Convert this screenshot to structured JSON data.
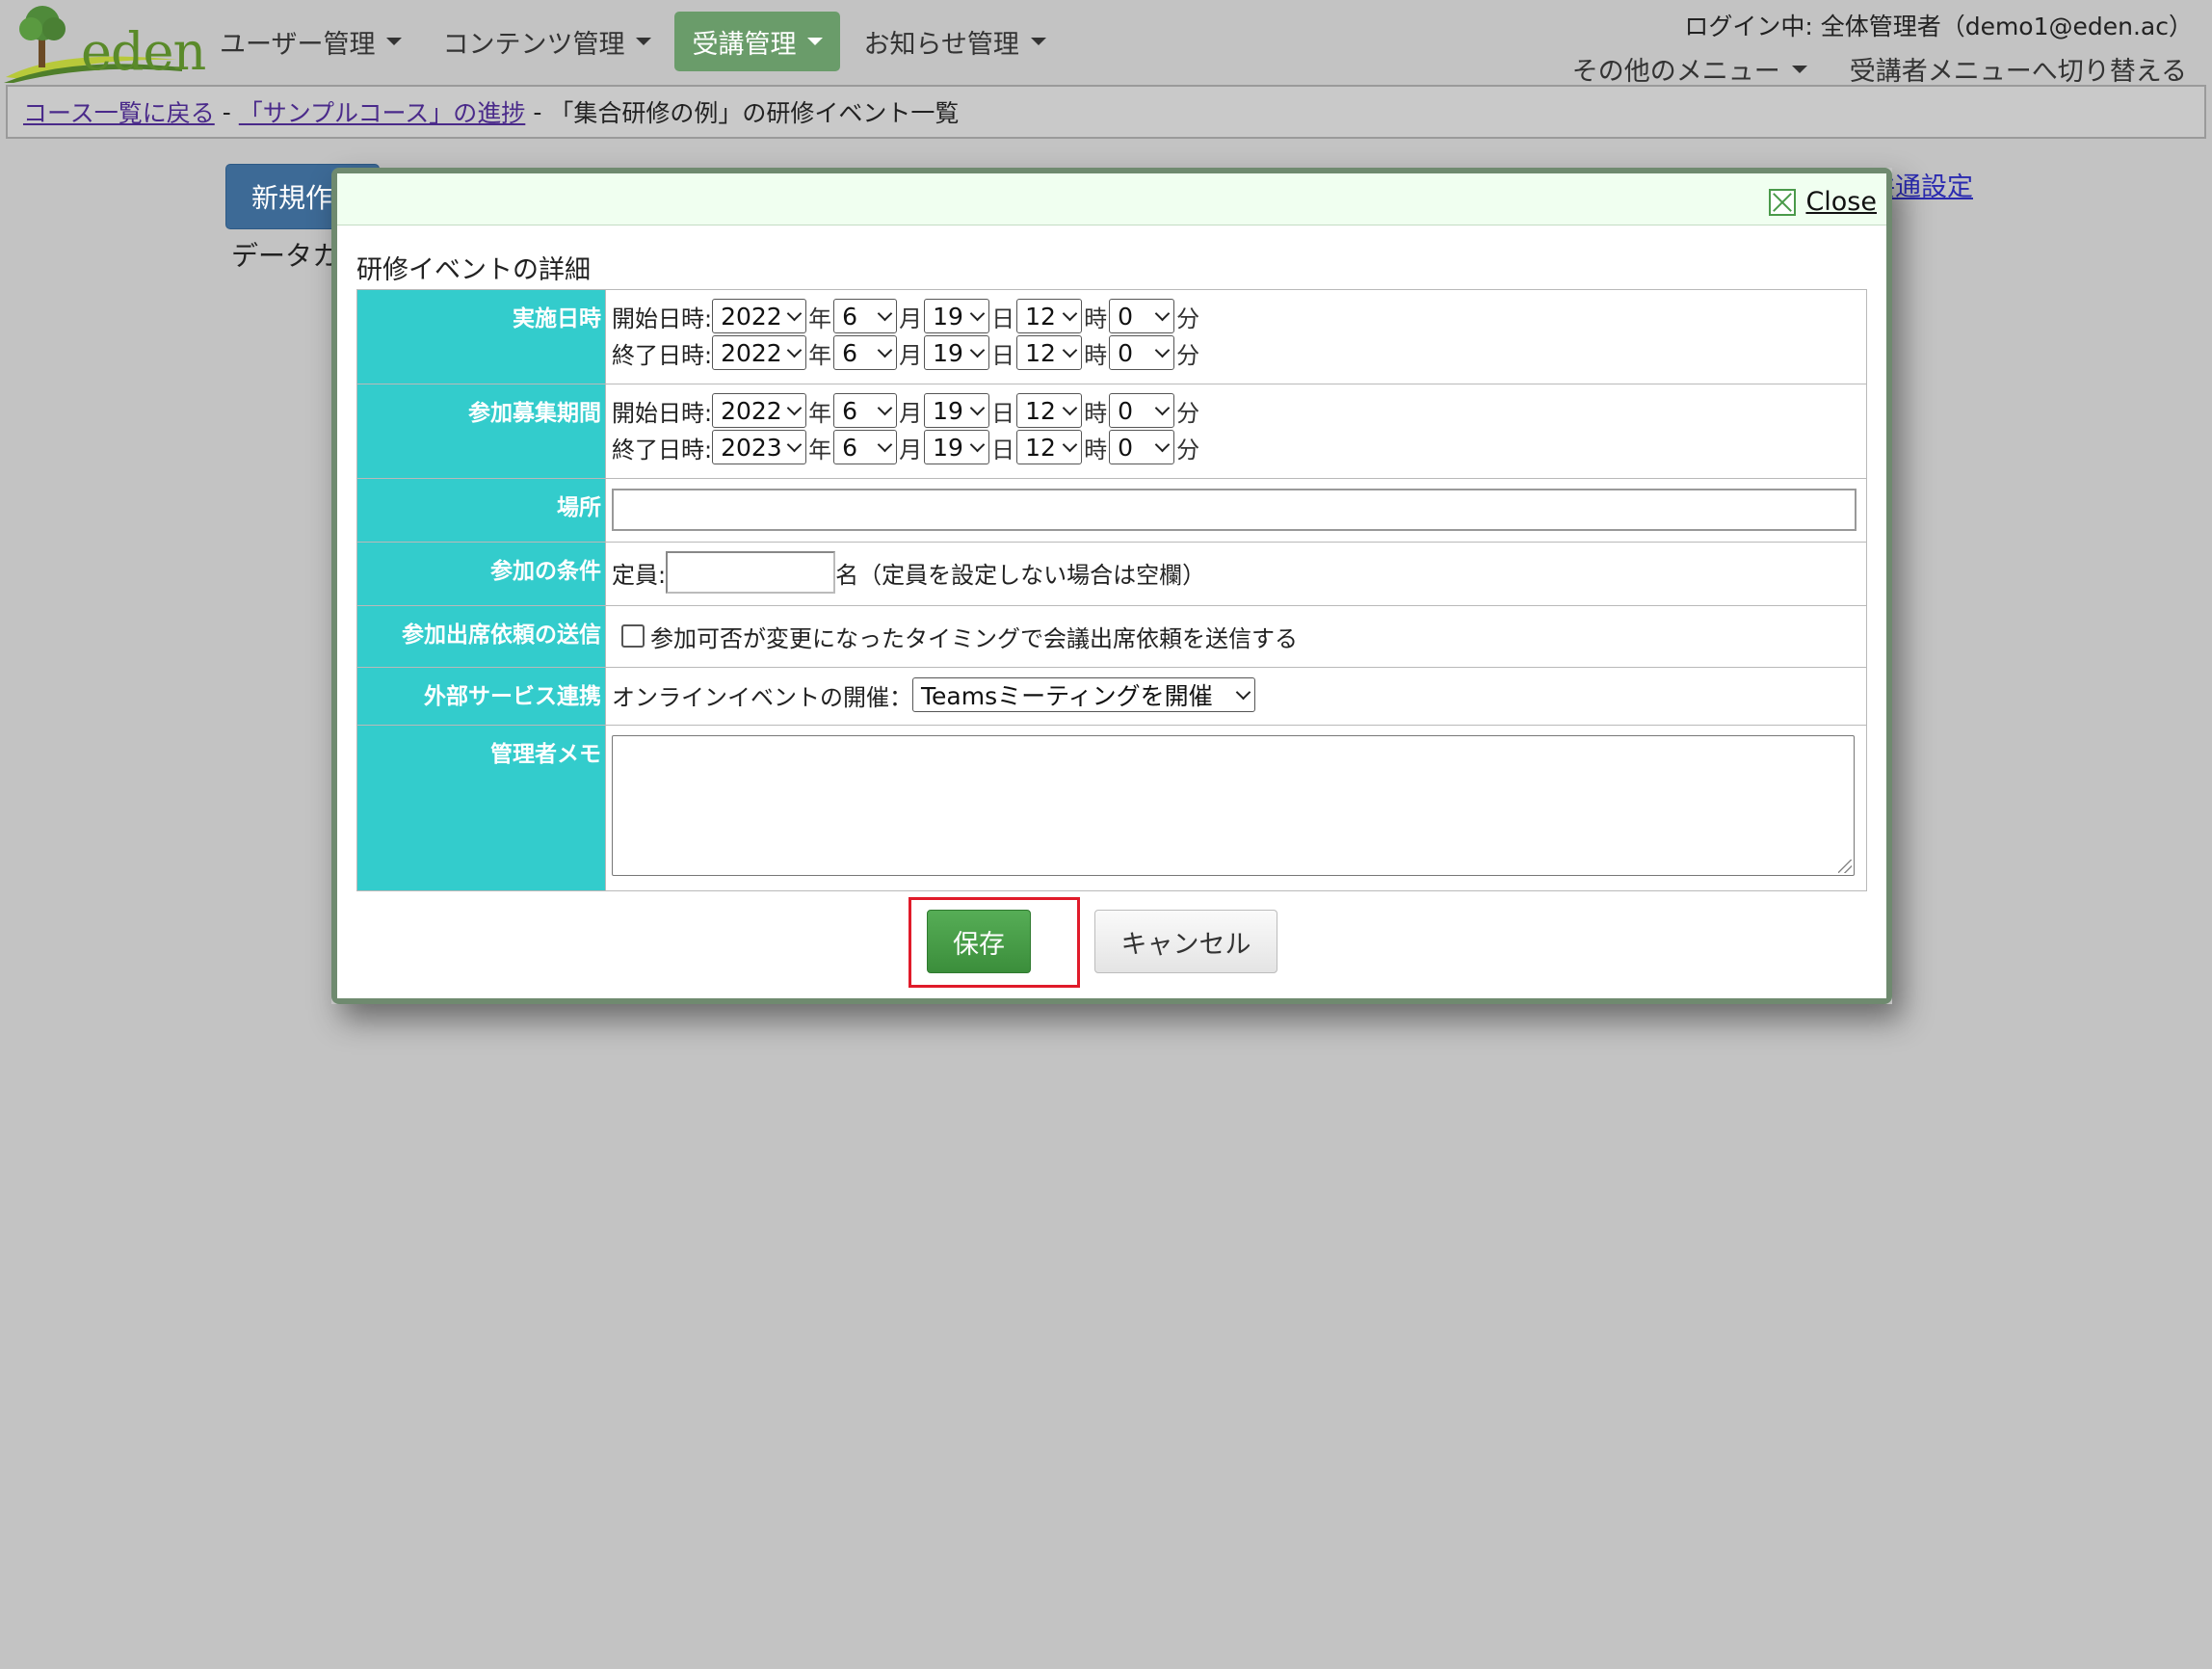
{
  "header": {
    "logo_text": "eden",
    "nav": [
      {
        "label": "ユーザー管理"
      },
      {
        "label": "コンテンツ管理"
      },
      {
        "label": "受講管理"
      },
      {
        "label": "お知らせ管理"
      }
    ],
    "login_info": "ログイン中: 全体管理者（demo1@eden.ac）",
    "other_menu": "その他のメニュー",
    "switch_menu": "受講者メニューへ切り替える"
  },
  "breadcrumb": {
    "course_list": "コース一覧に戻る",
    "sep1": "-",
    "course_progress": "「サンプルコース」の進捗",
    "sep2": "-",
    "current": "「集合研修の例」の研修イベント一覧"
  },
  "background": {
    "new_button": "新規作",
    "data_text": "データカ",
    "common_settings": "共通設定"
  },
  "modal": {
    "close_label": "Close",
    "title": "研修イベントの詳細",
    "units": {
      "year": "年",
      "month": "月",
      "day": "日",
      "hour": "時",
      "minute": "分"
    },
    "implementation": {
      "label": "実施日時",
      "start_label": "開始日時:",
      "end_label": "終了日時:",
      "start": {
        "year": "2022",
        "month": "6",
        "day": "19",
        "hour": "12",
        "minute": "0"
      },
      "end": {
        "year": "2022",
        "month": "6",
        "day": "19",
        "hour": "12",
        "minute": "0"
      }
    },
    "recruitment": {
      "label": "参加募集期間",
      "start_label": "開始日時:",
      "end_label": "終了日時:",
      "start": {
        "year": "2022",
        "month": "6",
        "day": "19",
        "hour": "12",
        "minute": "0"
      },
      "end": {
        "year": "2023",
        "month": "6",
        "day": "19",
        "hour": "12",
        "minute": "0"
      }
    },
    "place": {
      "label": "場所",
      "value": ""
    },
    "conditions": {
      "label": "参加の条件",
      "capacity_label": "定員:",
      "capacity_value": "",
      "capacity_suffix": "名（定員を設定しない場合は空欄）"
    },
    "attendance_request": {
      "label": "参加出席依頼の送信",
      "checkbox_label": "参加可否が変更になったタイミングで会議出席依頼を送信する",
      "checked": false
    },
    "external_service": {
      "label": "外部サービス連携",
      "online_label": "オンラインイベントの開催：",
      "selected": "Teamsミーティングを開催"
    },
    "admin_memo": {
      "label": "管理者メモ",
      "value": ""
    },
    "save_label": "保存",
    "cancel_label": "キャンセル"
  },
  "colors": {
    "label_bg": "#33cccc",
    "save_button": "#4a9e4a",
    "active_nav": "#6a9c6a",
    "highlight": "#e01b2a"
  }
}
